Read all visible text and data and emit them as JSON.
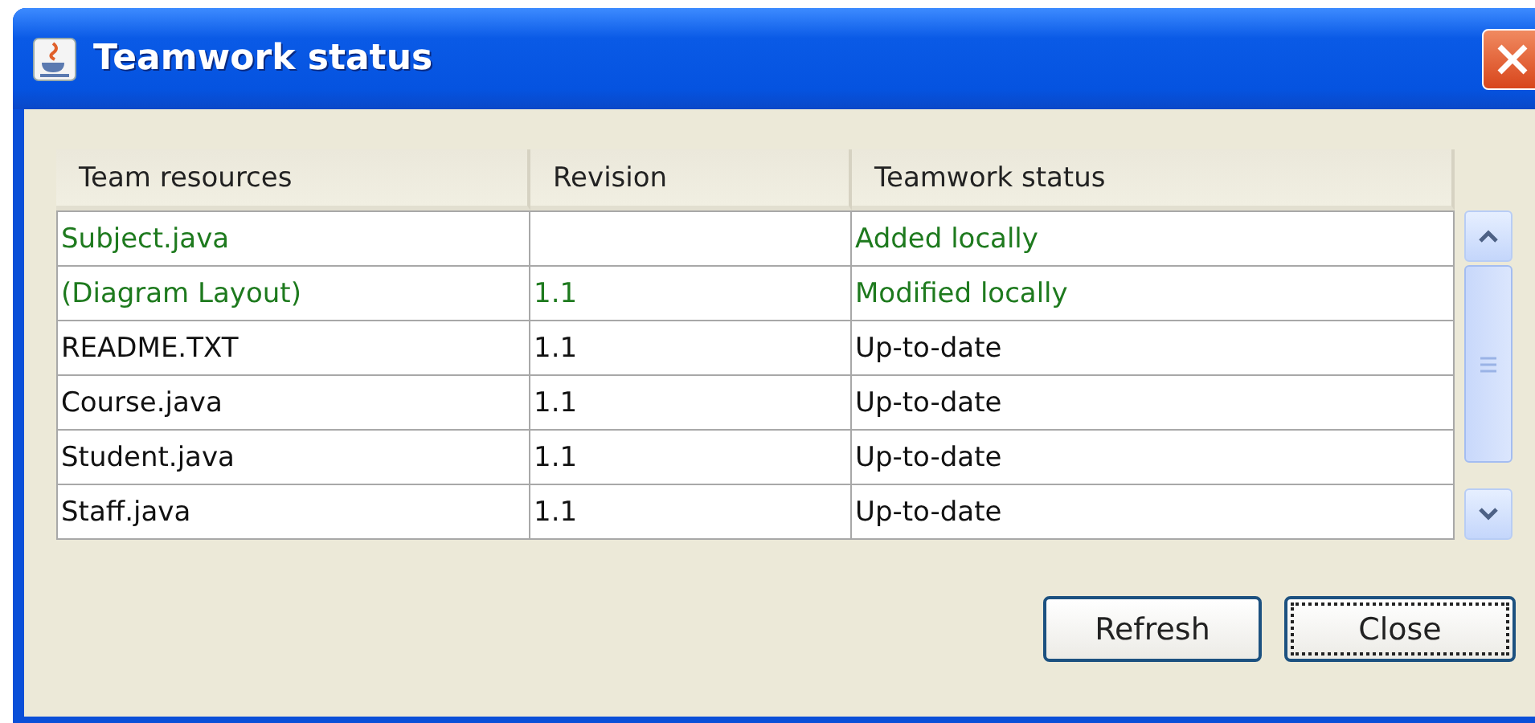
{
  "window": {
    "title": "Teamwork status"
  },
  "table": {
    "columns": [
      "Team resources",
      "Revision",
      "Teamwork status"
    ],
    "rows": [
      {
        "kind": "local",
        "cells": [
          "Subject.java",
          "",
          "Added locally"
        ]
      },
      {
        "kind": "local",
        "cells": [
          "(Diagram Layout)",
          "1.1",
          "Modified locally"
        ]
      },
      {
        "kind": "synced",
        "cells": [
          "README.TXT",
          "1.1",
          "Up-to-date"
        ]
      },
      {
        "kind": "synced",
        "cells": [
          "Course.java",
          "1.1",
          "Up-to-date"
        ]
      },
      {
        "kind": "synced",
        "cells": [
          "Student.java",
          "1.1",
          "Up-to-date"
        ]
      },
      {
        "kind": "synced",
        "cells": [
          "Staff.java",
          "1.1",
          "Up-to-date"
        ]
      }
    ]
  },
  "buttons": [
    {
      "label": "Refresh",
      "focused": false
    },
    {
      "label": "Close",
      "focused": true
    }
  ]
}
